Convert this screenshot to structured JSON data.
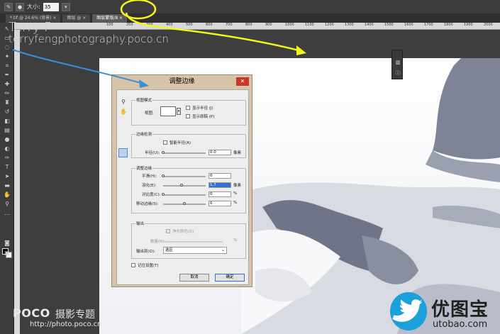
{
  "optionbar": {
    "size_label": "大小:",
    "size_value": "35"
  },
  "tabs": [
    {
      "label": "*.tif @ 24.6% (背景) ×"
    },
    {
      "label": "图层 @ ×"
    },
    {
      "label": "图层蒙版/8 ×"
    }
  ],
  "ruler": {
    "ticks": [
      "100",
      "200",
      "300",
      "400",
      "500",
      "600",
      "700",
      "800",
      "900",
      "1000",
      "1100",
      "1200",
      "1300",
      "1400",
      "1500",
      "1600",
      "1700",
      "1800",
      "1900",
      "2000"
    ]
  },
  "watermark": {
    "name": "Terry F",
    "site": "terryfengphotography.poco.cn"
  },
  "dialog": {
    "title": "调整边缘",
    "close": "✕",
    "view_mode": {
      "group": "视图模式",
      "view_label": "视图:",
      "show_radius": "显示半径 (J)",
      "show_original": "显示原稿 (P)"
    },
    "edge_detect": {
      "group": "边缘检测",
      "smart_radius": "智能半径(A)",
      "radius_label": "半径(U):",
      "radius_value": "0.0",
      "radius_unit": "像素"
    },
    "adjust_edge": {
      "group": "调整边缘",
      "rows": [
        {
          "label": "平滑(H):",
          "value": "0",
          "unit": ""
        },
        {
          "label": "羽化(E):",
          "value": "1.7",
          "unit": "像素"
        },
        {
          "label": "对比度(C):",
          "value": "0",
          "unit": "%"
        },
        {
          "label": "移动边缘(S):",
          "value": "0",
          "unit": "%"
        }
      ]
    },
    "output": {
      "group": "输出",
      "decontaminate": "净化颜色(D)",
      "amount_label": "数量(N):",
      "amount_unit": "%",
      "output_to_label": "输出到(O):",
      "output_to_value": "选区"
    },
    "remember": "记住设置(T)",
    "cancel": "取消",
    "ok": "确定"
  },
  "poco": {
    "brand": "POCO",
    "title": "摄影专题",
    "url": "http://photo.poco.cn"
  },
  "utobao": {
    "cn": "优图宝",
    "en": "utobao.com"
  },
  "colors": {
    "accent_yellow": "#f7f41a",
    "arrow_blue": "#3a8fd8",
    "close_red": "#c8352b"
  }
}
